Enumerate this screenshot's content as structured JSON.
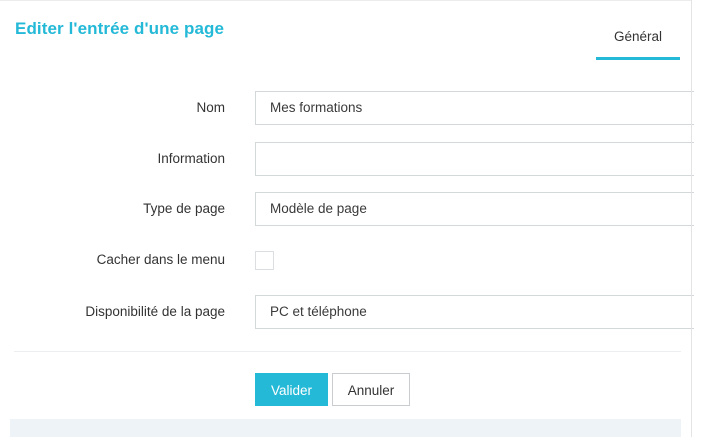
{
  "header": {
    "title": "Editer l'entrée d'une page"
  },
  "tabs": [
    {
      "label": "Général",
      "active": true
    }
  ],
  "form": {
    "nom": {
      "label": "Nom",
      "value": "Mes formations"
    },
    "information": {
      "label": "Information",
      "value": ""
    },
    "type_de_page": {
      "label": "Type de page",
      "value": "Modèle de page"
    },
    "cacher_dans_le_menu": {
      "label": "Cacher dans le menu",
      "checked": false
    },
    "disponibilite": {
      "label": "Disponibilité de la page",
      "value": "PC et téléphone"
    }
  },
  "actions": {
    "submit_label": "Valider",
    "cancel_label": "Annuler"
  },
  "colors": {
    "accent": "#24b9d7",
    "text": "#333333",
    "border": "#d3d8db",
    "footer_band": "#eef3f7"
  }
}
